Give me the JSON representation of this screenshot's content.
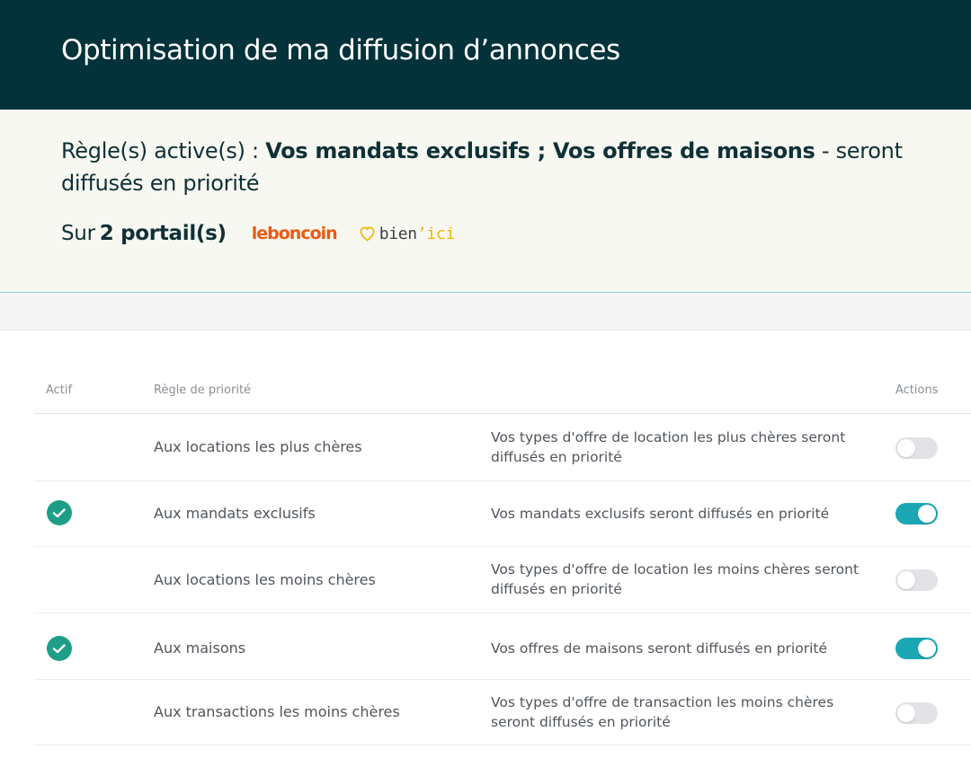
{
  "header": {
    "title": "Optimisation de ma diffusion d’annonces"
  },
  "summary": {
    "prefix": "Règle(s) active(s) : ",
    "active_rules": "Vos mandats exclusifs ; Vos offres de maisons",
    "suffix": " - seront diffusés en priorité",
    "portals_prefix": "Sur",
    "portals_count": "2 portail(s)",
    "portal_1": "leboncoin",
    "portal_2_a": "bien",
    "portal_2_sep": "’",
    "portal_2_b": "ici"
  },
  "table": {
    "col_active": "Actif",
    "col_rule": "Règle de priorité",
    "col_actions": "Actions",
    "rows": [
      {
        "name": "Aux locations les plus chères",
        "desc": "Vos types d'offre de location les plus chères seront diffusés en priorité",
        "active": false
      },
      {
        "name": "Aux mandats exclusifs",
        "desc": "Vos mandats exclusifs seront diffusés en priorité",
        "active": true
      },
      {
        "name": "Aux locations les moins chères",
        "desc": "Vos types d'offre de location les moins chères seront diffusés en priorité",
        "active": false
      },
      {
        "name": "Aux maisons",
        "desc": "Vos offres de maisons seront diffusés en priorité",
        "active": true
      },
      {
        "name": "Aux transactions les moins chères",
        "desc": "Vos types d'offre de transaction les moins chères seront diffusés en priorité",
        "active": false
      }
    ]
  },
  "colors": {
    "header_bg": "#03323a",
    "accent": "#1aa6b3",
    "check": "#1e9e86",
    "leboncoin": "#ec5a13",
    "bienici": "#f4b500"
  },
  "icons": {
    "check": "check-circle-icon",
    "bienici_logo": "house-heart-icon"
  }
}
